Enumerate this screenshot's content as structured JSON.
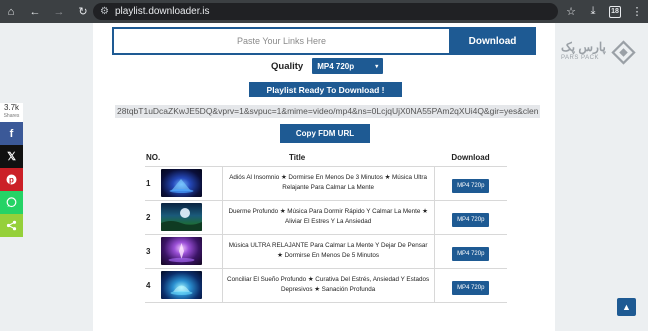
{
  "browser": {
    "url": "playlist.downloader.is",
    "tab_count": "18"
  },
  "form": {
    "paste_placeholder": "Paste Your Links Here",
    "download_label": "Download",
    "quality_label": "Quality",
    "quality_value": "MP4 720p",
    "ready_label": "Playlist Ready To Download !",
    "link_text": "28tqbT1uDcaZKwJE5DQ&vprv=1&svpuc=1&mime=video/mp4&ns=0LcjqUjX0NA55PAm2qXUi4Q&gir=yes&clen",
    "copy_label": "Copy FDM URL"
  },
  "table": {
    "headers": {
      "no": "NO.",
      "title": "Title",
      "download": "Download"
    },
    "rows": [
      {
        "no": "1",
        "title": "Adiós Al Insomnio ★ Dormirse En Menos De 3 Minutos ★ Música Ultra Relajante Para Calmar La Mente",
        "button": "MP4 720p"
      },
      {
        "no": "2",
        "title": "Duerme Profundo ★ Música Para Dormir Rápido Y Calmar La Mente ★ Aliviar El Estres Y La Ansiedad",
        "button": "MP4 720p"
      },
      {
        "no": "3",
        "title": "Música ULTRA RELAJANTE Para Calmar La Mente Y Dejar De Pensar ★ Dormirse En Menos De 5 Minutos",
        "button": "MP4 720p"
      },
      {
        "no": "4",
        "title": "Conciliar El Sueño Profundo ★ Curativa Del Estrés, Ansiedad Y Estados Depresivos ★ Sanación Profunda",
        "button": "MP4 720p"
      }
    ]
  },
  "share": {
    "count": "3.7k",
    "label": "Shares",
    "buttons": [
      {
        "name": "facebook",
        "color": "#3b5998"
      },
      {
        "name": "x",
        "color": "#111111"
      },
      {
        "name": "pinterest",
        "color": "#cb2027"
      },
      {
        "name": "whatsapp",
        "color": "#25d366"
      },
      {
        "name": "sharethis",
        "color": "#95d03a"
      }
    ]
  },
  "logo": {
    "text_fa": "پارس پک",
    "text_en": "PARS PACK"
  },
  "colors": {
    "accent": "#1e5a93",
    "chrome_bg": "#3c4043",
    "page_bg": "#eceff1"
  }
}
